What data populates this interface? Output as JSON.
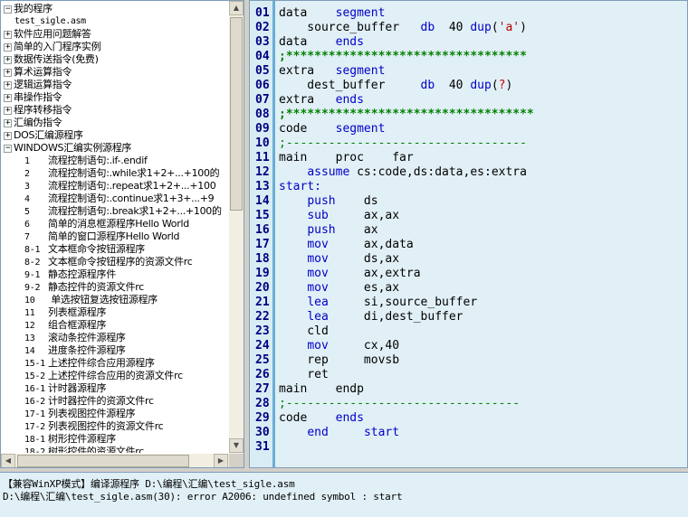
{
  "tree": {
    "items": [
      {
        "level": 0,
        "toggle": "−",
        "label": "我的程序",
        "mono": false
      },
      {
        "level": 1,
        "toggle": "",
        "label": "test_sigle.asm",
        "mono": true
      },
      {
        "level": 0,
        "toggle": "+",
        "label": "软件应用问题解答",
        "mono": false
      },
      {
        "level": 0,
        "toggle": "+",
        "label": "简单的入门程序实例",
        "mono": false
      },
      {
        "level": 0,
        "toggle": "+",
        "label": "数据传送指令(免费)",
        "mono": false
      },
      {
        "level": 0,
        "toggle": "+",
        "label": "算术运算指令",
        "mono": false
      },
      {
        "level": 0,
        "toggle": "+",
        "label": "逻辑运算指令",
        "mono": false
      },
      {
        "level": 0,
        "toggle": "+",
        "label": "串操作指令",
        "mono": false
      },
      {
        "level": 0,
        "toggle": "+",
        "label": "程序转移指令",
        "mono": false
      },
      {
        "level": 0,
        "toggle": "+",
        "label": "汇编伪指令",
        "mono": false
      },
      {
        "level": 0,
        "toggle": "+",
        "label": "DOS汇编源程序",
        "mono": false
      },
      {
        "level": 0,
        "toggle": "−",
        "label": "WINDOWS汇编实例源程序",
        "mono": false
      },
      {
        "level": 2,
        "toggle": "",
        "num": "1",
        "label": "流程控制语句:.if-.endif",
        "mono": false
      },
      {
        "level": 2,
        "toggle": "",
        "num": "2",
        "label": "流程控制语句:.while求1+2+...+100的",
        "mono": false
      },
      {
        "level": 2,
        "toggle": "",
        "num": "3",
        "label": "流程控制语句:.repeat求1+2+...+100",
        "mono": false
      },
      {
        "level": 2,
        "toggle": "",
        "num": "4",
        "label": "流程控制语句:.continue求1+3+...+9",
        "mono": false
      },
      {
        "level": 2,
        "toggle": "",
        "num": "5",
        "label": "流程控制语句:.break求1+2+...+100的",
        "mono": false
      },
      {
        "level": 2,
        "toggle": "",
        "num": "6",
        "label": "简单的消息框源程序Hello World",
        "mono": false
      },
      {
        "level": 2,
        "toggle": "",
        "num": "7",
        "label": "简单的窗口源程序Hello World",
        "mono": false
      },
      {
        "level": 2,
        "toggle": "",
        "num": "8-1",
        "label": "文本框命令按钮源程序",
        "mono": false
      },
      {
        "level": 2,
        "toggle": "",
        "num": "8-2",
        "label": "文本框命令按钮程序的资源文件rc",
        "mono": false
      },
      {
        "level": 2,
        "toggle": "",
        "num": "9-1",
        "label": "静态控源程序件",
        "mono": false
      },
      {
        "level": 2,
        "toggle": "",
        "num": "9-2",
        "label": "静态控件的资源文件rc",
        "mono": false
      },
      {
        "level": 2,
        "toggle": "",
        "num": "10",
        "label": "  单选按钮复选按钮源程序",
        "mono": false
      },
      {
        "level": 2,
        "toggle": "",
        "num": "11",
        "label": "列表框源程序",
        "mono": false
      },
      {
        "level": 2,
        "toggle": "",
        "num": "12",
        "label": "组合框源程序",
        "mono": false
      },
      {
        "level": 2,
        "toggle": "",
        "num": "13",
        "label": "滚动条控件源程序",
        "mono": false
      },
      {
        "level": 2,
        "toggle": "",
        "num": "14",
        "label": "进度条控件源程序",
        "mono": false
      },
      {
        "level": 2,
        "toggle": "",
        "num": "15-1",
        "label": "上述控件综合应用源程序",
        "mono": false
      },
      {
        "level": 2,
        "toggle": "",
        "num": "15-2",
        "label": "上述控件综合应用的资源文件rc",
        "mono": false
      },
      {
        "level": 2,
        "toggle": "",
        "num": "16-1",
        "label": "计时器源程序",
        "mono": false
      },
      {
        "level": 2,
        "toggle": "",
        "num": "16-2",
        "label": "计时器控件的资源文件rc",
        "mono": false
      },
      {
        "level": 2,
        "toggle": "",
        "num": "17-1",
        "label": "列表视图控件源程序",
        "mono": false
      },
      {
        "level": 2,
        "toggle": "",
        "num": "17-2",
        "label": "列表视图控件的资源文件rc",
        "mono": false
      },
      {
        "level": 2,
        "toggle": "",
        "num": "18-1",
        "label": "树形控件源程序",
        "mono": false
      },
      {
        "level": 2,
        "toggle": "",
        "num": "18-2",
        "label": "树形控件的资源文件rc",
        "mono": false
      }
    ]
  },
  "scroll_icons": {
    "up": "arrow-up-icon",
    "down": "arrow-down-icon",
    "left": "arrow-left-icon",
    "right": "arrow-right-icon"
  },
  "editor": {
    "lines": [
      {
        "n": "01",
        "segs": [
          [
            "t",
            "data    "
          ],
          [
            "kw",
            "segment"
          ]
        ]
      },
      {
        "n": "02",
        "segs": [
          [
            "t",
            "    source_buffer   "
          ],
          [
            "kw",
            "db"
          ],
          [
            "t",
            "  40 "
          ],
          [
            "kw",
            "dup"
          ],
          [
            "t",
            "("
          ],
          [
            "str",
            "'a'"
          ],
          [
            "t",
            ")"
          ]
        ]
      },
      {
        "n": "03",
        "segs": [
          [
            "t",
            "data    "
          ],
          [
            "kw",
            "ends"
          ]
        ]
      },
      {
        "n": "04",
        "segs": [
          [
            "cm",
            ";**********************************"
          ]
        ]
      },
      {
        "n": "05",
        "segs": [
          [
            "t",
            "extra   "
          ],
          [
            "kw",
            "segment"
          ]
        ]
      },
      {
        "n": "06",
        "segs": [
          [
            "t",
            "    dest_buffer     "
          ],
          [
            "kw",
            "db"
          ],
          [
            "t",
            "  40 "
          ],
          [
            "kw",
            "dup"
          ],
          [
            "t",
            "("
          ],
          [
            "q",
            "?"
          ],
          [
            "t",
            ")"
          ]
        ]
      },
      {
        "n": "07",
        "segs": [
          [
            "t",
            "extra   "
          ],
          [
            "kw",
            "ends"
          ]
        ]
      },
      {
        "n": "08",
        "segs": [
          [
            "cm",
            ";***********************************"
          ]
        ]
      },
      {
        "n": "09",
        "segs": [
          [
            "t",
            "code    "
          ],
          [
            "kw",
            "segment"
          ]
        ]
      },
      {
        "n": "10",
        "segs": [
          [
            "cmd",
            ";----------------------------------"
          ]
        ]
      },
      {
        "n": "11",
        "segs": [
          [
            "t",
            "main    proc    far"
          ]
        ]
      },
      {
        "n": "12",
        "segs": [
          [
            "t",
            "    "
          ],
          [
            "kw",
            "assume"
          ],
          [
            "t",
            " cs:code,ds:data,es:extra"
          ]
        ]
      },
      {
        "n": "13",
        "segs": [
          [
            "kw",
            "start:"
          ]
        ]
      },
      {
        "n": "14",
        "segs": [
          [
            "t",
            "    "
          ],
          [
            "kw",
            "push"
          ],
          [
            "t",
            "    ds"
          ]
        ]
      },
      {
        "n": "15",
        "segs": [
          [
            "t",
            "    "
          ],
          [
            "kw",
            "sub"
          ],
          [
            "t",
            "     ax,ax"
          ]
        ]
      },
      {
        "n": "16",
        "segs": [
          [
            "t",
            "    "
          ],
          [
            "kw",
            "push"
          ],
          [
            "t",
            "    ax"
          ]
        ]
      },
      {
        "n": "17",
        "segs": [
          [
            "t",
            "    "
          ],
          [
            "kw",
            "mov"
          ],
          [
            "t",
            "     ax,data"
          ]
        ]
      },
      {
        "n": "18",
        "segs": [
          [
            "t",
            "    "
          ],
          [
            "kw",
            "mov"
          ],
          [
            "t",
            "     ds,ax"
          ]
        ]
      },
      {
        "n": "19",
        "segs": [
          [
            "t",
            "    "
          ],
          [
            "kw",
            "mov"
          ],
          [
            "t",
            "     ax,extra"
          ]
        ]
      },
      {
        "n": "20",
        "segs": [
          [
            "t",
            "    "
          ],
          [
            "kw",
            "mov"
          ],
          [
            "t",
            "     es,ax"
          ]
        ]
      },
      {
        "n": "21",
        "segs": [
          [
            "t",
            "    "
          ],
          [
            "kw",
            "lea"
          ],
          [
            "t",
            "     si,source_buffer"
          ]
        ]
      },
      {
        "n": "22",
        "segs": [
          [
            "t",
            "    "
          ],
          [
            "kw",
            "lea"
          ],
          [
            "t",
            "     di,dest_buffer"
          ]
        ]
      },
      {
        "n": "23",
        "segs": [
          [
            "t",
            "    cld"
          ]
        ]
      },
      {
        "n": "24",
        "segs": [
          [
            "t",
            "    "
          ],
          [
            "kw",
            "mov"
          ],
          [
            "t",
            "     cx,40"
          ]
        ]
      },
      {
        "n": "25",
        "segs": [
          [
            "t",
            "    rep     movsb"
          ]
        ]
      },
      {
        "n": "26",
        "segs": [
          [
            "t",
            "    ret"
          ]
        ]
      },
      {
        "n": "27",
        "segs": [
          [
            "t",
            "main    endp"
          ]
        ]
      },
      {
        "n": "28",
        "segs": [
          [
            "cmd",
            ";---------------------------------"
          ]
        ]
      },
      {
        "n": "29",
        "segs": [
          [
            "t",
            "code    "
          ],
          [
            "kw",
            "ends"
          ]
        ]
      },
      {
        "n": "30",
        "segs": [
          [
            "t",
            "    "
          ],
          [
            "kw",
            "end"
          ],
          [
            "t",
            "     "
          ],
          [
            "kw",
            "start"
          ]
        ]
      },
      {
        "n": "31",
        "segs": []
      }
    ]
  },
  "output": {
    "line1": "【兼容WinXP模式】编译源程序 D:\\编程\\汇编\\test_sigle.asm",
    "line2": "D:\\编程\\汇编\\test_sigle.asm(30): error A2006: undefined symbol : start"
  }
}
